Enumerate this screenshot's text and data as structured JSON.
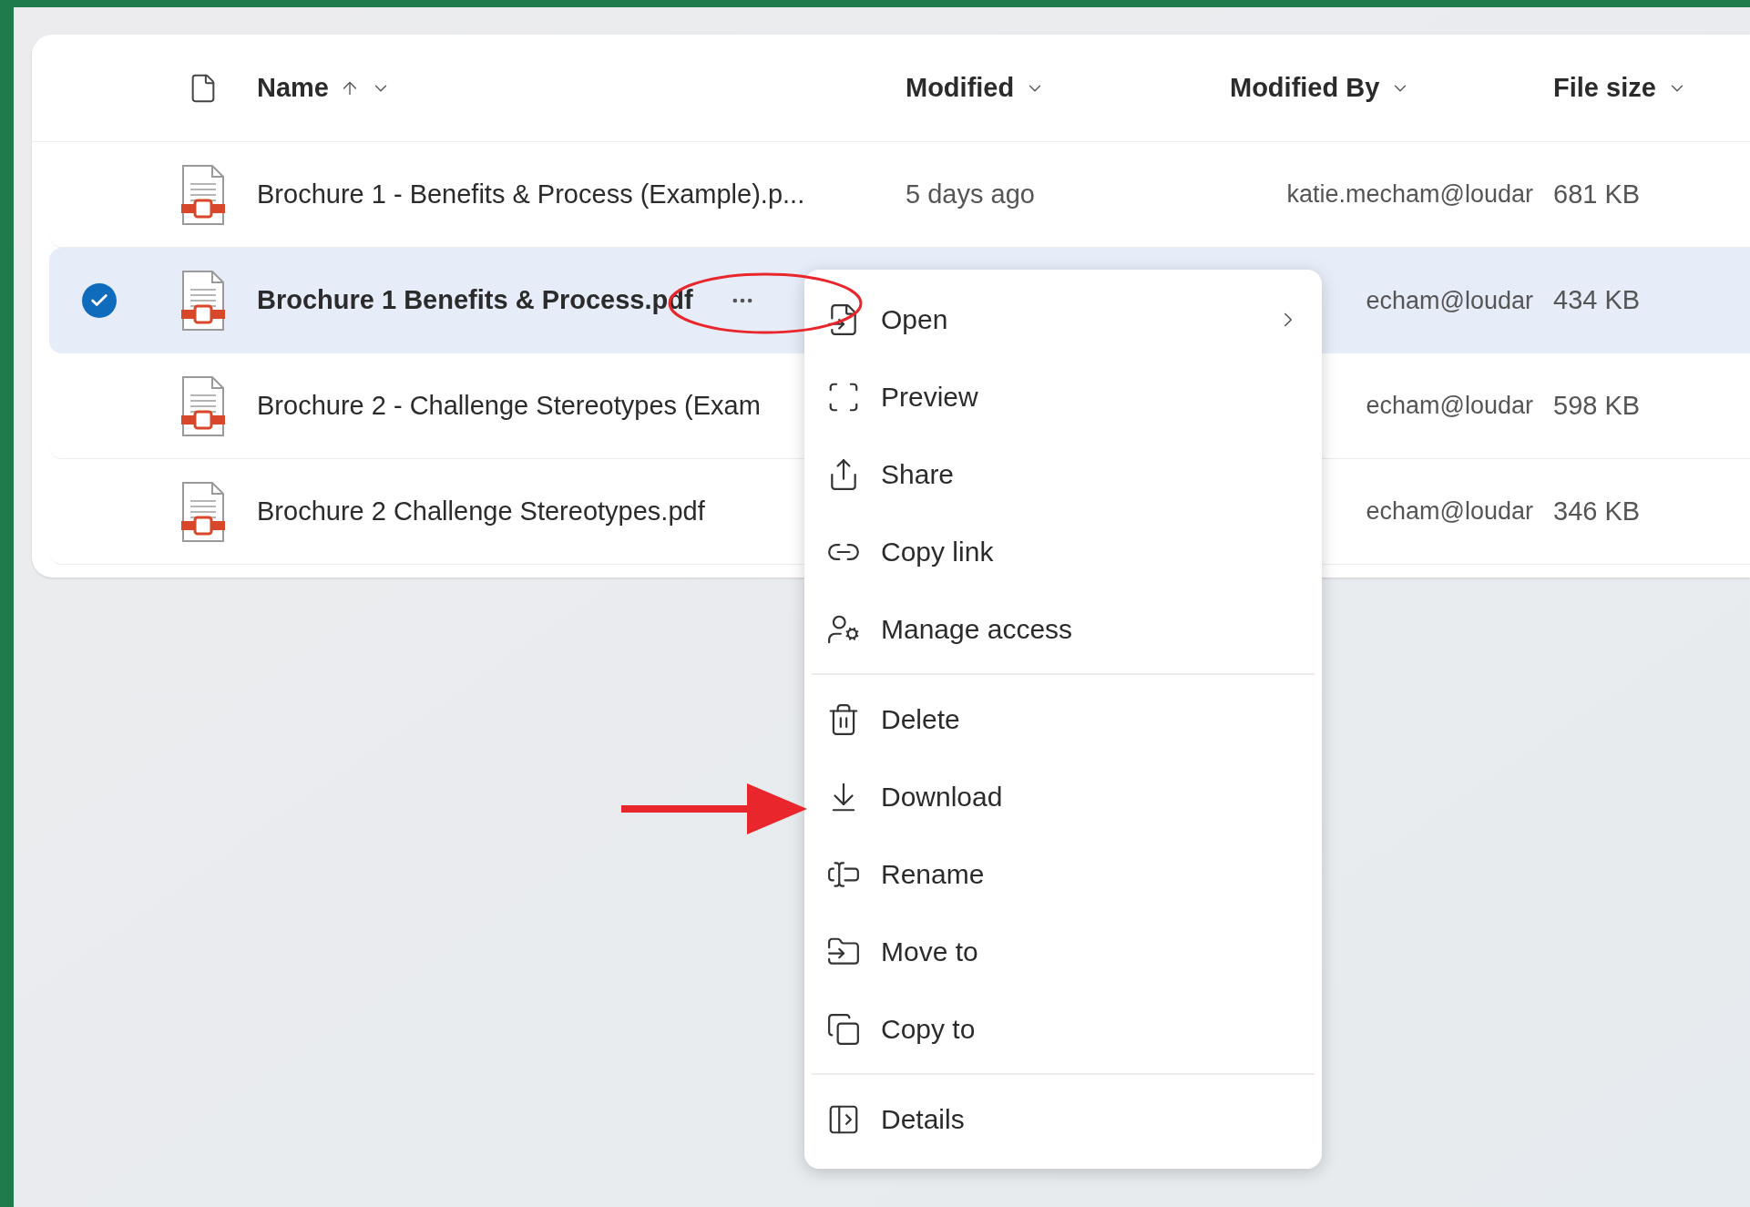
{
  "table": {
    "columns": [
      {
        "label": "Name",
        "sorted": true
      },
      {
        "label": "Modified",
        "sorted": false
      },
      {
        "label": "Modified By",
        "sorted": false
      },
      {
        "label": "File size",
        "sorted": false
      }
    ],
    "rows": [
      {
        "name": "Brochure 1 - Benefits & Process (Example).p...",
        "modified": "5 days ago",
        "modified_by": "katie.mecham@loudar",
        "size": "681 KB",
        "selected": false
      },
      {
        "name": "Brochure 1 Benefits & Process.pdf",
        "modified_by": "echam@loudar",
        "size": "434 KB",
        "selected": true
      },
      {
        "name": "Brochure 2 - Challenge Stereotypes (Exam",
        "modified_by": "echam@loudar",
        "size": "598 KB",
        "selected": false
      },
      {
        "name": "Brochure 2 Challenge Stereotypes.pdf",
        "modified_by": "echam@loudar",
        "size": "346 KB",
        "selected": false
      }
    ]
  },
  "context_menu": {
    "groups": [
      [
        {
          "label": "Open",
          "submenu": true
        },
        {
          "label": "Preview",
          "submenu": false
        },
        {
          "label": "Share",
          "submenu": false
        },
        {
          "label": "Copy link",
          "submenu": false
        },
        {
          "label": "Manage access",
          "submenu": false
        }
      ],
      [
        {
          "label": "Delete",
          "submenu": false
        },
        {
          "label": "Download",
          "submenu": false
        },
        {
          "label": "Rename",
          "submenu": false
        },
        {
          "label": "Move to",
          "submenu": false
        },
        {
          "label": "Copy to",
          "submenu": false
        }
      ],
      [
        {
          "label": "Details",
          "submenu": false
        }
      ]
    ]
  }
}
